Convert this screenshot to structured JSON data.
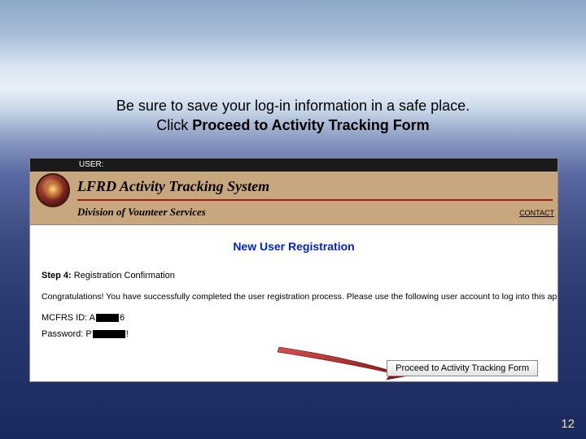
{
  "instruction": {
    "line1": "Be sure to save your log-in information in a safe place.",
    "line2_prefix": "Click ",
    "line2_bold": "Proceed to Activity Tracking Form"
  },
  "topbar": {
    "user_label": "USER:"
  },
  "banner": {
    "title": "LFRD Activity Tracking System",
    "subtitle": "Division of Vounteer Services",
    "contact": "CONTACT"
  },
  "content": {
    "reg_title": "New User Registration",
    "step_bold": "Step 4:",
    "step_rest": " Registration Confirmation",
    "congrats": "Congratulations! You have successfully completed the user registration process. Please use the following user account to log into this application.",
    "mcfrs_label": "MCFRS ID: A",
    "mcfrs_suffix": "6",
    "pw_label": "Password: P",
    "pw_suffix": "!"
  },
  "button": {
    "proceed": "Proceed to Activity Tracking Form"
  },
  "page_number": "12"
}
